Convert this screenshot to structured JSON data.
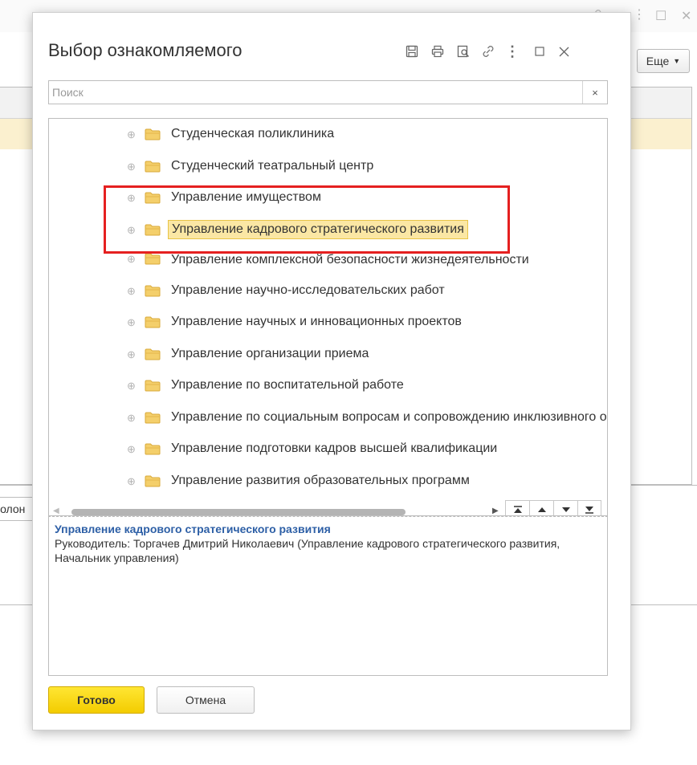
{
  "background": {
    "more_button_label": "Еще",
    "tab_label": "Полон"
  },
  "dialog": {
    "title": "Выбор ознакомляемого",
    "toolbar": [
      {
        "icon": "save-icon"
      },
      {
        "icon": "print-icon"
      },
      {
        "icon": "preview-icon"
      },
      {
        "icon": "link-icon"
      },
      {
        "icon": "more-icon"
      },
      {
        "icon": "maximize-icon"
      },
      {
        "icon": "close-icon"
      }
    ],
    "search": {
      "placeholder": "Поиск",
      "value": "",
      "clear": "×"
    },
    "tree": {
      "items": [
        {
          "label": "Студенческая поликлиника"
        },
        {
          "label": "Студенческий театральный центр"
        },
        {
          "label": "Управление имуществом"
        },
        {
          "label": "Управление кадрового стратегического развития",
          "selected": true
        },
        {
          "label": "Управление комплексной безопасности жизнедеятельности"
        },
        {
          "label": "Управление научно-исследовательских работ"
        },
        {
          "label": "Управление научных и инновационных проектов"
        },
        {
          "label": "Управление организации приема"
        },
        {
          "label": "Управление по воспитательной работе"
        },
        {
          "label": "Управление по социальным вопросам и сопровождению инклюзивного образования"
        },
        {
          "label": "Управление подготовки кадров высшей квалификации"
        },
        {
          "label": "Управление развития образовательных программ"
        }
      ],
      "expander_glyph": "⊕"
    },
    "details": {
      "title": "Управление кадрового стратегического развития",
      "text": "Руководитель: Торгачев Дмитрий Николаевич (Управление кадрового стратегического развития, Начальник управления)"
    },
    "buttons": {
      "done": "Готово",
      "cancel": "Отмена"
    }
  },
  "colors": {
    "accent_yellow": "#f7d51a",
    "selected_row": "#fbe7a4",
    "highlight_red": "#e52020",
    "details_title": "#2d5fa6"
  }
}
